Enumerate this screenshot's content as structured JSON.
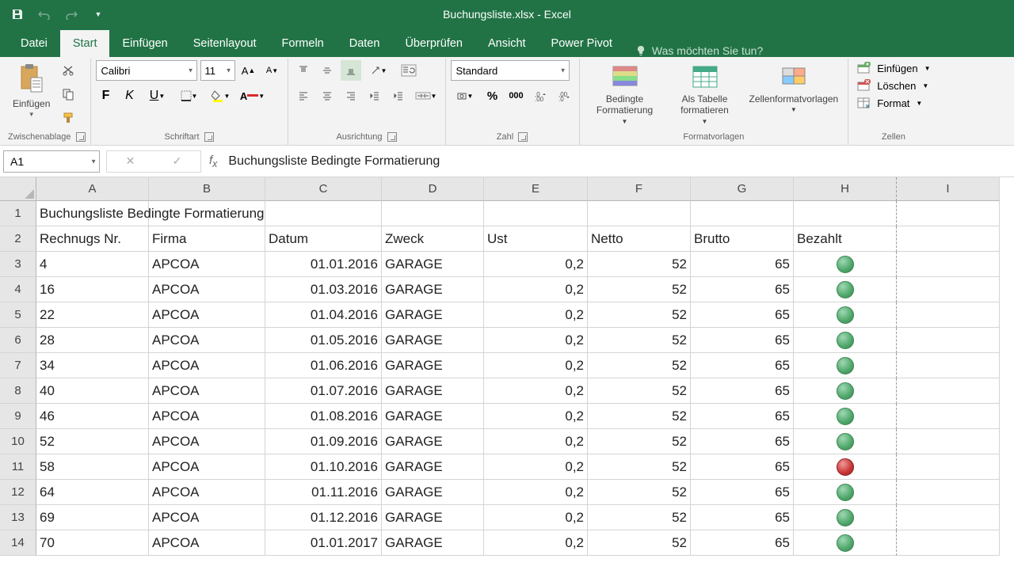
{
  "titlebar": {
    "title": "Buchungsliste.xlsx - Excel"
  },
  "tabs": {
    "file": "Datei",
    "home": "Start",
    "insert": "Einfügen",
    "layout": "Seitenlayout",
    "formulas": "Formeln",
    "data": "Daten",
    "review": "Überprüfen",
    "view": "Ansicht",
    "powerpivot": "Power Pivot",
    "tellme": "Was möchten Sie tun?"
  },
  "ribbon": {
    "clipboard": {
      "paste": "Einfügen",
      "group": "Zwischenablage"
    },
    "font": {
      "name": "Calibri",
      "size": "11",
      "group": "Schriftart",
      "bold": "F",
      "italic": "K",
      "underline": "U"
    },
    "alignment": {
      "group": "Ausrichtung"
    },
    "number": {
      "format": "Standard",
      "group": "Zahl"
    },
    "styles": {
      "cond": "Bedingte Formatierung",
      "table": "Als Tabelle formatieren",
      "cell": "Zellenformatvorlagen",
      "group": "Formatvorlagen"
    },
    "cells": {
      "insert": "Einfügen",
      "delete": "Löschen",
      "format": "Format",
      "group": "Zellen"
    }
  },
  "formulaBar": {
    "nameBox": "A1",
    "formula": "Buchungsliste Bedingte Formatierung"
  },
  "columns": [
    "A",
    "B",
    "C",
    "D",
    "E",
    "F",
    "G",
    "H",
    "I"
  ],
  "rowNumbers": [
    "1",
    "2",
    "3",
    "4",
    "5",
    "6",
    "7",
    "8",
    "9",
    "10",
    "11",
    "12",
    "13",
    "14"
  ],
  "titleRow": "Buchungsliste Bedingte Formatierung",
  "headers": {
    "nr": "Rechnugs Nr.",
    "firma": "Firma",
    "datum": "Datum",
    "zweck": "Zweck",
    "ust": "Ust",
    "netto": "Netto",
    "brutto": "Brutto",
    "bezahlt": "Bezahlt"
  },
  "rows": [
    {
      "nr": "4",
      "firma": "APCOA",
      "datum": "01.01.2016",
      "zweck": "GARAGE",
      "ust": "0,2",
      "netto": "52",
      "brutto": "65",
      "paid": "green"
    },
    {
      "nr": "16",
      "firma": "APCOA",
      "datum": "01.03.2016",
      "zweck": "GARAGE",
      "ust": "0,2",
      "netto": "52",
      "brutto": "65",
      "paid": "green"
    },
    {
      "nr": "22",
      "firma": "APCOA",
      "datum": "01.04.2016",
      "zweck": "GARAGE",
      "ust": "0,2",
      "netto": "52",
      "brutto": "65",
      "paid": "green"
    },
    {
      "nr": "28",
      "firma": "APCOA",
      "datum": "01.05.2016",
      "zweck": "GARAGE",
      "ust": "0,2",
      "netto": "52",
      "brutto": "65",
      "paid": "green"
    },
    {
      "nr": "34",
      "firma": "APCOA",
      "datum": "01.06.2016",
      "zweck": "GARAGE",
      "ust": "0,2",
      "netto": "52",
      "brutto": "65",
      "paid": "green"
    },
    {
      "nr": "40",
      "firma": "APCOA",
      "datum": "01.07.2016",
      "zweck": "GARAGE",
      "ust": "0,2",
      "netto": "52",
      "brutto": "65",
      "paid": "green"
    },
    {
      "nr": "46",
      "firma": "APCOA",
      "datum": "01.08.2016",
      "zweck": "GARAGE",
      "ust": "0,2",
      "netto": "52",
      "brutto": "65",
      "paid": "green"
    },
    {
      "nr": "52",
      "firma": "APCOA",
      "datum": "01.09.2016",
      "zweck": "GARAGE",
      "ust": "0,2",
      "netto": "52",
      "brutto": "65",
      "paid": "green"
    },
    {
      "nr": "58",
      "firma": "APCOA",
      "datum": "01.10.2016",
      "zweck": "GARAGE",
      "ust": "0,2",
      "netto": "52",
      "brutto": "65",
      "paid": "red"
    },
    {
      "nr": "64",
      "firma": "APCOA",
      "datum": "01.11.2016",
      "zweck": "GARAGE",
      "ust": "0,2",
      "netto": "52",
      "brutto": "65",
      "paid": "green"
    },
    {
      "nr": "69",
      "firma": "APCOA",
      "datum": "01.12.2016",
      "zweck": "GARAGE",
      "ust": "0,2",
      "netto": "52",
      "brutto": "65",
      "paid": "green"
    },
    {
      "nr": "70",
      "firma": "APCOA",
      "datum": "01.01.2017",
      "zweck": "GARAGE",
      "ust": "0,2",
      "netto": "52",
      "brutto": "65",
      "paid": "green"
    }
  ]
}
